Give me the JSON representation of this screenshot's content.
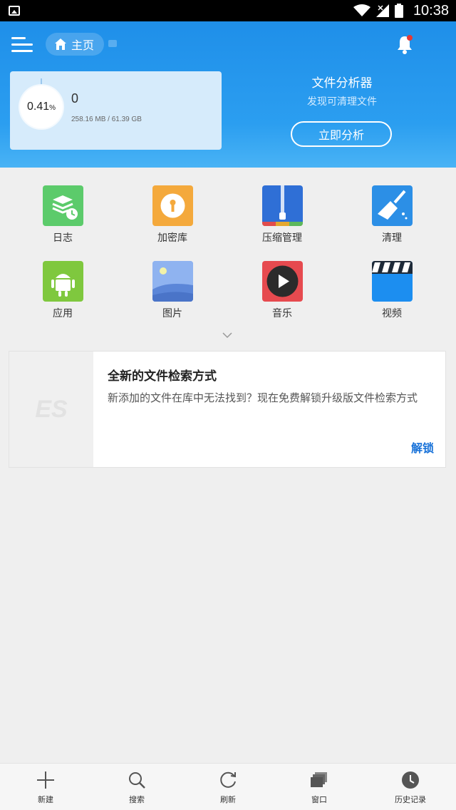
{
  "status_bar": {
    "time": "10:38"
  },
  "header": {
    "home_chip_label": "主页",
    "storage": {
      "percent": "0.41",
      "percent_unit": "%",
      "count": "0",
      "size": "258.16 MB / 61.39 GB"
    },
    "analyzer": {
      "title": "文件分析器",
      "subtitle": "发现可清理文件",
      "button_label": "立即分析"
    }
  },
  "categories": [
    {
      "label": "日志",
      "icon": "log-icon",
      "color": "#5ccb6b"
    },
    {
      "label": "加密库",
      "icon": "keyhole-icon",
      "color": "#f4a93c"
    },
    {
      "label": "压缩管理",
      "icon": "zip-icon",
      "color": "#2f6fd6"
    },
    {
      "label": "清理",
      "icon": "broom-icon",
      "color": "#2c8fe6"
    },
    {
      "label": "应用",
      "icon": "android-icon",
      "color": "#7fc83e"
    },
    {
      "label": "图片",
      "icon": "image-icon",
      "color": "#6e9be8"
    },
    {
      "label": "音乐",
      "icon": "play-icon",
      "color": "#e64a4f"
    },
    {
      "label": "视频",
      "icon": "clapper-icon",
      "color": "#1c8ef0"
    }
  ],
  "promo": {
    "logo_text": "ES",
    "title": "全新的文件检索方式",
    "description": "新添加的文件在库中无法找到？现在免费解锁升级版文件检索方式",
    "action_label": "解锁"
  },
  "bottom_bar": [
    {
      "label": "新建",
      "icon": "plus-icon"
    },
    {
      "label": "搜索",
      "icon": "search-icon"
    },
    {
      "label": "刷新",
      "icon": "refresh-icon"
    },
    {
      "label": "窗口",
      "icon": "windows-icon"
    },
    {
      "label": "历史记录",
      "icon": "history-icon"
    }
  ]
}
